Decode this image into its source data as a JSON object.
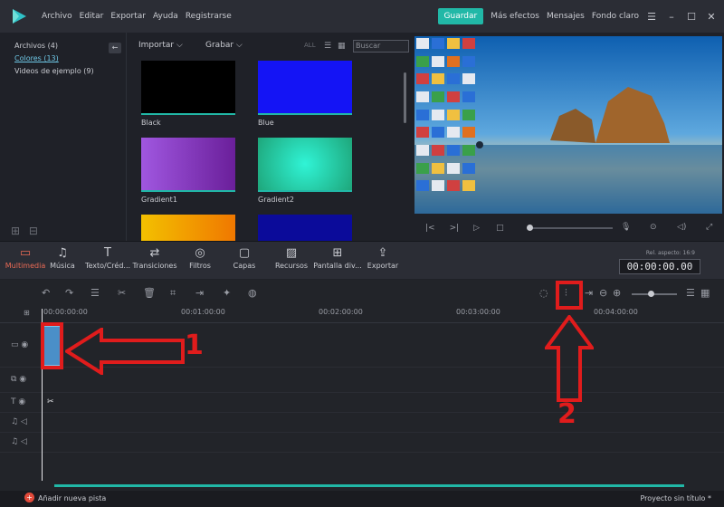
{
  "menubar": {
    "items": [
      "Archivo",
      "Editar",
      "Exportar",
      "Ayuda",
      "Registrarse"
    ],
    "save_label": "Guardar",
    "links": [
      "Más efectos",
      "Mensajes",
      "Fondo claro"
    ],
    "window_controls": [
      "☰",
      "–",
      "☐",
      "✕"
    ]
  },
  "library": {
    "items": [
      {
        "label": "Archivos (4)",
        "active": false
      },
      {
        "label": "Colores (13)",
        "active": true
      },
      {
        "label": "Videos de ejemplo (9)",
        "active": false
      }
    ],
    "collapse": "←"
  },
  "media_toolbar": {
    "import": "Importar ⌵",
    "record": "Grabar ⌵",
    "all": "ALL",
    "search_placeholder": "Buscar"
  },
  "thumbs": [
    {
      "label": "Black",
      "color": "#000000"
    },
    {
      "label": "Blue",
      "color": "#1414f5"
    },
    {
      "label": "Gradient1",
      "color": "#8e3fd0"
    },
    {
      "label": "Gradient2",
      "color": "#24d6a6"
    },
    {
      "label": "",
      "color": "#f0a000"
    },
    {
      "label": "",
      "color": "#0b0b9a"
    }
  ],
  "modules": [
    {
      "label": "Multimedia",
      "glyph": "▭",
      "active": true
    },
    {
      "label": "Música",
      "glyph": "♫",
      "active": false
    },
    {
      "label": "Texto/Créd...",
      "glyph": "T",
      "active": false
    },
    {
      "label": "Transiciones",
      "glyph": "⇄",
      "active": false
    },
    {
      "label": "Filtros",
      "glyph": "◎",
      "active": false
    },
    {
      "label": "Capas",
      "glyph": "▢",
      "active": false
    },
    {
      "label": "Recursos",
      "glyph": "▨",
      "active": false
    },
    {
      "label": "Pantalla div...",
      "glyph": "⊞",
      "active": false
    },
    {
      "label": "Exportar",
      "glyph": "⇪",
      "active": false
    }
  ],
  "preview": {
    "aspect": "Rel. aspecto: 16:9",
    "timecode": "00:00:00.00"
  },
  "timeline": {
    "ruler": [
      "00:00:00:00",
      "00:01:00:00",
      "00:02:00:00",
      "00:03:00:00",
      "00:04:00:00"
    ],
    "add_track": "Añadir nueva pista",
    "project": "Proyecto sin título *"
  },
  "annotations": {
    "one": "1",
    "two": "2",
    "color": "#e01c1c"
  }
}
